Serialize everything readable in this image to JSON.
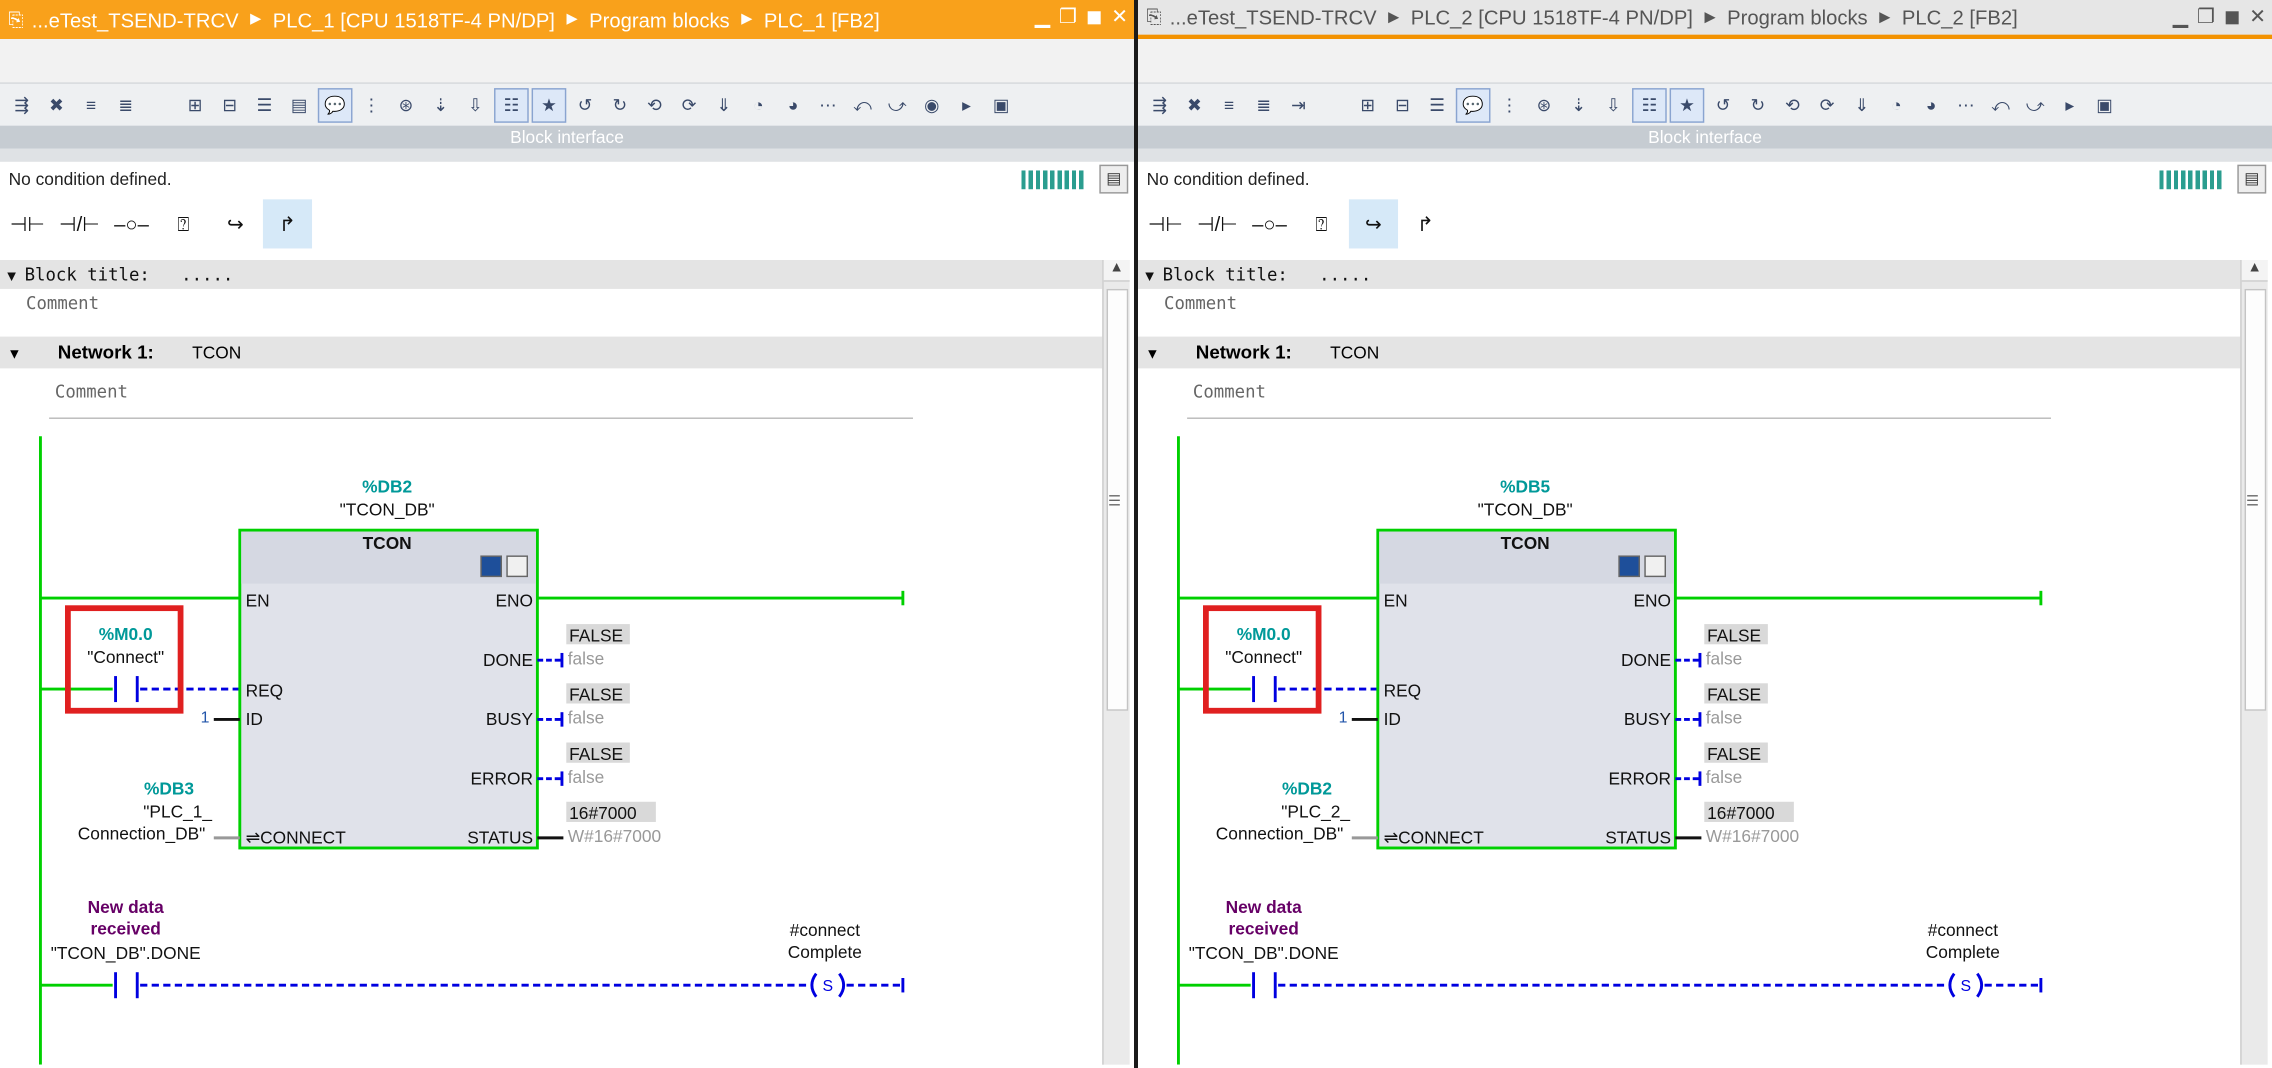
{
  "panels": [
    {
      "breadcrumbs": [
        "...eTest_TSEND-TRCV",
        "PLC_1 [CPU 1518TF-4 PN/DP]",
        "Program blocks",
        "PLC_1 [FB2]"
      ],
      "block_interface_label": "Block interface",
      "condition_text": "No condition defined.",
      "block_title_label": "Block title:",
      "block_title_value": ".....",
      "comment_placeholder": "Comment",
      "network_label": "Network 1:",
      "network_name": "TCON",
      "network_comment": "Comment",
      "instance_db_addr": "%DB2",
      "instance_db_name": "\"TCON_DB\"",
      "block_name": "TCON",
      "pins_in": [
        "EN",
        "REQ",
        "ID",
        "⇌CONNECT"
      ],
      "pins_out": [
        "ENO",
        "DONE",
        "BUSY",
        "ERROR",
        "STATUS"
      ],
      "req_contact_addr": "%M0.0",
      "req_contact_name": "\"Connect\"",
      "id_value": "1",
      "connect_db_addr": "%DB3",
      "connect_db_name_1": "\"PLC_1_",
      "connect_db_name_2": "Connection_DB\"",
      "done_monitor": "FALSE",
      "done_value": "false",
      "busy_monitor": "FALSE",
      "busy_value": "false",
      "error_monitor": "FALSE",
      "error_value": "false",
      "status_monitor": "16#7000",
      "status_value": "W#16#7000",
      "rung2_label_1": "New data",
      "rung2_label_2": "received",
      "rung2_operand": "\"TCON_DB\".DONE",
      "coil_label_1": "#connect",
      "coil_label_2": "Complete",
      "coil_symbol": "S"
    },
    {
      "breadcrumbs": [
        "...eTest_TSEND-TRCV",
        "PLC_2 [CPU 1518TF-4 PN/DP]",
        "Program blocks",
        "PLC_2 [FB2]"
      ],
      "block_interface_label": "Block interface",
      "condition_text": "No condition defined.",
      "block_title_label": "Block title:",
      "block_title_value": ".....",
      "comment_placeholder": "Comment",
      "network_label": "Network 1:",
      "network_name": "TCON",
      "network_comment": "Comment",
      "instance_db_addr": "%DB5",
      "instance_db_name": "\"TCON_DB\"",
      "block_name": "TCON",
      "pins_in": [
        "EN",
        "REQ",
        "ID",
        "⇌CONNECT"
      ],
      "pins_out": [
        "ENO",
        "DONE",
        "BUSY",
        "ERROR",
        "STATUS"
      ],
      "req_contact_addr": "%M0.0",
      "req_contact_name": "\"Connect\"",
      "id_value": "1",
      "connect_db_addr": "%DB2",
      "connect_db_name_1": "\"PLC_2_",
      "connect_db_name_2": "Connection_DB\"",
      "done_monitor": "FALSE",
      "done_value": "false",
      "busy_monitor": "FALSE",
      "busy_value": "false",
      "error_monitor": "FALSE",
      "error_value": "false",
      "status_monitor": "16#7000",
      "status_value": "W#16#7000",
      "rung2_label_1": "New data",
      "rung2_label_2": "received",
      "rung2_operand": "\"TCON_DB\".DONE",
      "coil_label_1": "#connect",
      "coil_label_2": "Complete",
      "coil_symbol": "S"
    }
  ],
  "colors": {
    "active_titlebar": "#f9a11b",
    "power_rail": "#00d000",
    "dashed_wire": "#0000e0",
    "db_address": "#009999",
    "highlight_box": "#e02020",
    "rung2_label": "#660066",
    "monitor_bg": "#d9d9d9"
  },
  "icons": [
    "pin-icon",
    "minimize-icon",
    "restore-icon",
    "maximize-icon",
    "close-icon"
  ]
}
